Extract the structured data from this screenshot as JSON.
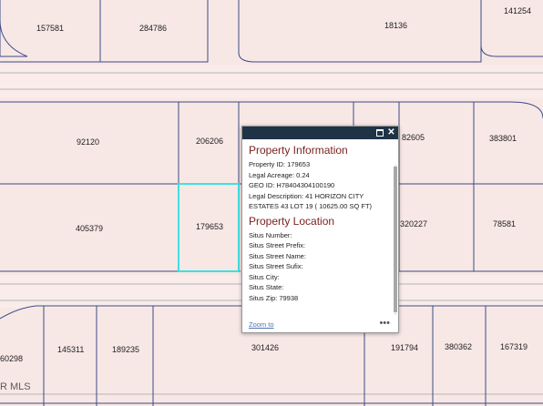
{
  "map": {
    "parcels": [
      {
        "id": "157581"
      },
      {
        "id": "284786"
      },
      {
        "id": "18136"
      },
      {
        "id": "141254"
      },
      {
        "id": "92120"
      },
      {
        "id": "206206"
      },
      {
        "id": "82605"
      },
      {
        "id": "383801"
      },
      {
        "id": "405379"
      },
      {
        "id": "179653"
      },
      {
        "id": "320227"
      },
      {
        "id": "78581"
      },
      {
        "id": "60298"
      },
      {
        "id": "145311"
      },
      {
        "id": "189235"
      },
      {
        "id": "301426"
      },
      {
        "id": "191794"
      },
      {
        "id": "380362"
      },
      {
        "id": "167319"
      }
    ],
    "selected_parcel": "179653",
    "watermark": "R MLS",
    "colors": {
      "background": "#f7e8e6",
      "parcel_border": "#3c4a86",
      "highlight": "#3ee0e0",
      "road_edge": "#b5b5b5"
    }
  },
  "popup": {
    "section1_title": "Property Information",
    "property_id": "Property ID: 179653",
    "legal_acreage": "Legal Acreage: 0.24",
    "geo_id": "GEO ID: H78404304100190",
    "legal_description_1": "Legal Description: 41 HORIZON CITY",
    "legal_description_2": "ESTATES 43 LOT 19 ( 10625.00 SQ FT)",
    "section2_title": "Property Location",
    "situs_number": "Situs Number:",
    "situs_street_prefix": "Situs Street Prefix:",
    "situs_street_name": "Situs Street Name:",
    "situs_street_sufix": "Situs Street Sufix:",
    "situs_city": "Situs City:",
    "situs_state": "Situs State:",
    "situs_zip": "Situs Zip: 79938",
    "zoom_to": "Zoom to",
    "more": "•••",
    "close": "✕",
    "maximize_icon": "maximize-icon",
    "header_color": "#1f3347",
    "title_color": "#7a1f1f"
  }
}
